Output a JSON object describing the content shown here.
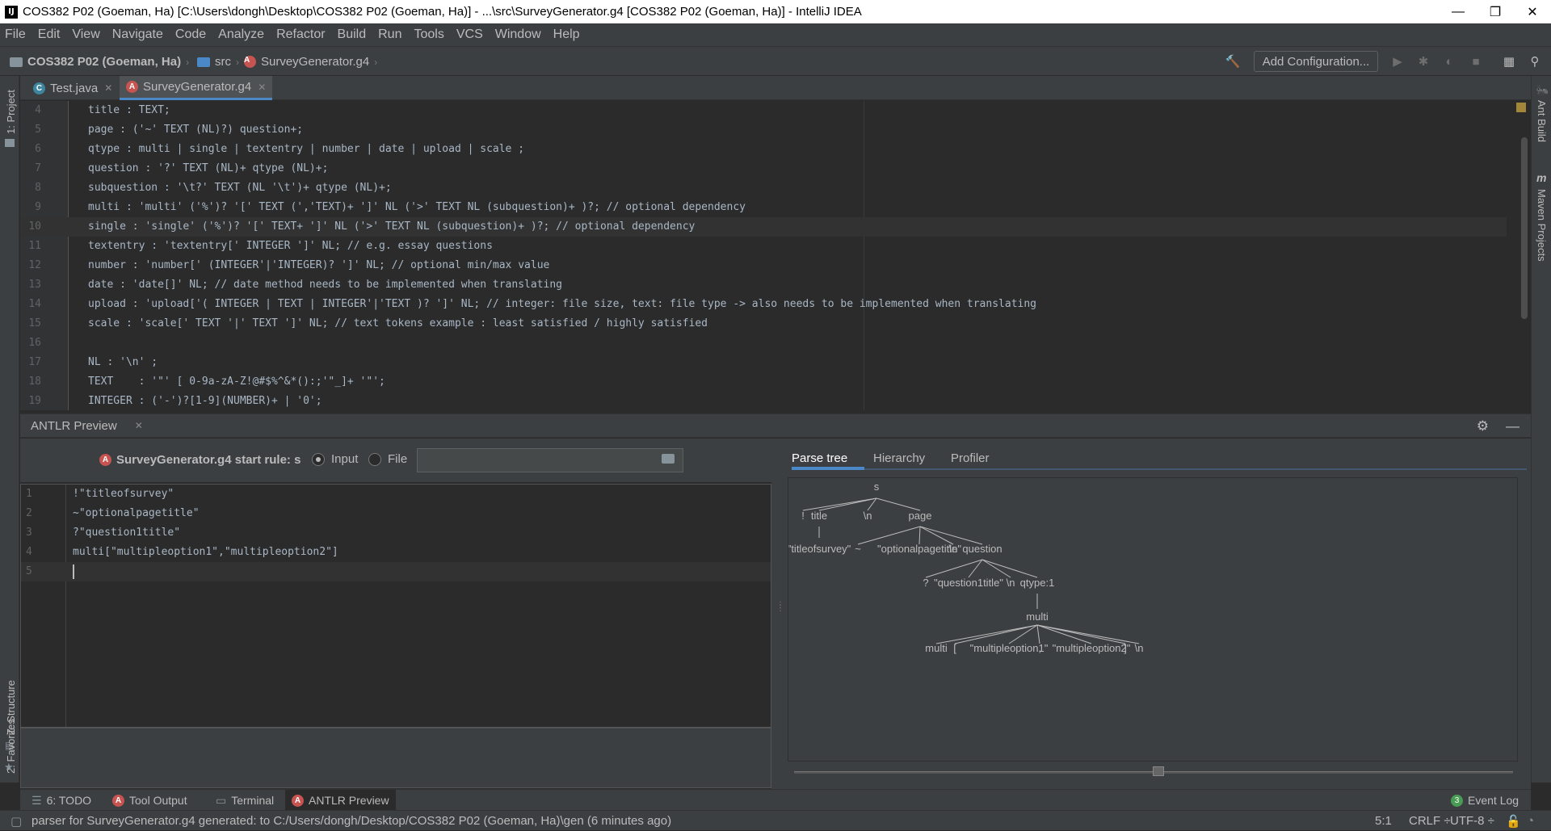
{
  "window": {
    "app_icon": "IJ",
    "title": "COS382 P02 (Goeman, Ha) [C:\\Users\\dongh\\Desktop\\COS382 P02 (Goeman, Ha)] - ...\\src\\SurveyGenerator.g4 [COS382 P02 (Goeman, Ha)] - IntelliJ IDEA",
    "minimize": "—",
    "restore": "❐",
    "close": "✕"
  },
  "menu": [
    "File",
    "Edit",
    "View",
    "Navigate",
    "Code",
    "Analyze",
    "Refactor",
    "Build",
    "Run",
    "Tools",
    "VCS",
    "Window",
    "Help"
  ],
  "breadcrumbs": {
    "project": "COS382 P02 (Goeman, Ha)",
    "folder": "src",
    "file": "SurveyGenerator.g4"
  },
  "toolbar": {
    "add_configuration": "Add Configuration...",
    "icons": [
      "hammer-icon",
      "run-icon",
      "debug-icon",
      "coverage-icon",
      "stop-icon",
      "project-structure-icon",
      "search-everywhere-icon"
    ]
  },
  "left_tools": {
    "project": "1: Project",
    "structure": "Z: Structure",
    "favorites": "2: Favorites"
  },
  "right_tools": {
    "ant_build": "Ant Build",
    "maven": "Maven Projects"
  },
  "editor_tabs": [
    {
      "label": "Test.java",
      "active": false
    },
    {
      "label": "SurveyGenerator.g4",
      "active": true
    }
  ],
  "editor_lines": [
    {
      "n": "4",
      "t": "title : TEXT;"
    },
    {
      "n": "5",
      "t": "page : ('~' TEXT (NL)?) question+;"
    },
    {
      "n": "6",
      "t": "qtype : multi | single | textentry | number | date | upload | scale ;"
    },
    {
      "n": "7",
      "t": "question : '?' TEXT (NL)+ qtype (NL)+;"
    },
    {
      "n": "8",
      "t": "subquestion : '\\t?' TEXT (NL '\\t')+ qtype (NL)+;"
    },
    {
      "n": "9",
      "t": "multi : 'multi' ('%')? '[' TEXT (','TEXT)+ ']' NL ('>' TEXT NL (subquestion)+ )?; // optional dependency"
    },
    {
      "n": "10",
      "t": "single : 'single' ('%')? '[' TEXT+ ']' NL ('>' TEXT NL (subquestion)+ )?; // optional dependency"
    },
    {
      "n": "11",
      "t": "textentry : 'textentry[' INTEGER ']' NL; // e.g. essay questions"
    },
    {
      "n": "12",
      "t": "number : 'number[' (INTEGER'|'INTEGER)? ']' NL; // optional min/max value"
    },
    {
      "n": "13",
      "t": "date : 'date[]' NL; // date method needs to be implemented when translating"
    },
    {
      "n": "14",
      "t": "upload : 'upload['( INTEGER | TEXT | INTEGER'|'TEXT )? ']' NL; // integer: file size, text: file type -> also needs to be implemented when translating"
    },
    {
      "n": "15",
      "t": "scale : 'scale[' TEXT '|' TEXT ']' NL; // text tokens example : least satisfied / highly satisfied"
    },
    {
      "n": "16",
      "t": ""
    },
    {
      "n": "17",
      "t": "NL : '\\n' ;"
    },
    {
      "n": "18",
      "t": "TEXT    : '\"' [ 0-9a-zA-Z!@#$%^&*():;'\"_]+ '\"';"
    },
    {
      "n": "19",
      "t": "INTEGER : ('-')?[1-9](NUMBER)+ | '0';"
    }
  ],
  "antlr": {
    "panel_title": "ANTLR Preview",
    "grammar_label": "SurveyGenerator.g4 start rule: s",
    "radio_input": "Input",
    "radio_file": "File",
    "file_path": "",
    "input_lines": [
      {
        "n": "1",
        "t": "!\"titleofsurvey\""
      },
      {
        "n": "2",
        "t": "~\"optionalpagetitle\""
      },
      {
        "n": "3",
        "t": "?\"question1title\""
      },
      {
        "n": "4",
        "t": "multi[\"multipleoption1\",\"multipleoption2\"]"
      },
      {
        "n": "5",
        "t": ""
      }
    ],
    "tabs": [
      "Parse tree",
      "Hierarchy",
      "Profiler"
    ],
    "tree": {
      "s": "s",
      "bang": "!",
      "title": "title",
      "nl1": "\\n",
      "page": "page",
      "titleofsurvey": "\"titleofsurvey\"",
      "tilde": "~",
      "optionalpagetitle": "\"optionalpagetitle\"",
      "nl2": "\\n",
      "question": "question",
      "qmark": "?",
      "question1title": "\"question1title\"",
      "nl3": "\\n",
      "qtype": "qtype:1",
      "multi_rule": "multi",
      "multi_tok": "multi",
      "lbracket": "[",
      "opt1": "\"multipleoption1\"",
      "comma": ",",
      "opt2": "\"multipleoption2\"",
      "rbracket": "]",
      "nl4": "\\n"
    }
  },
  "bottom_tools": [
    {
      "label": "6: TODO",
      "icon": "todo-icon"
    },
    {
      "label": "Tool Output",
      "icon": "antlr-icon"
    },
    {
      "label": "Terminal",
      "icon": "terminal-icon"
    },
    {
      "label": "ANTLR Preview",
      "icon": "antlr-icon"
    }
  ],
  "event_log": {
    "label": "Event Log",
    "count": "3"
  },
  "status": {
    "message": "parser for SurveyGenerator.g4 generated: to C:/Users/dongh/Desktop/COS382 P02 (Goeman, Ha)\\gen (6 minutes ago)",
    "position": "5:1",
    "line_sep": "CRLF ÷",
    "encoding": "UTF-8 ÷"
  }
}
